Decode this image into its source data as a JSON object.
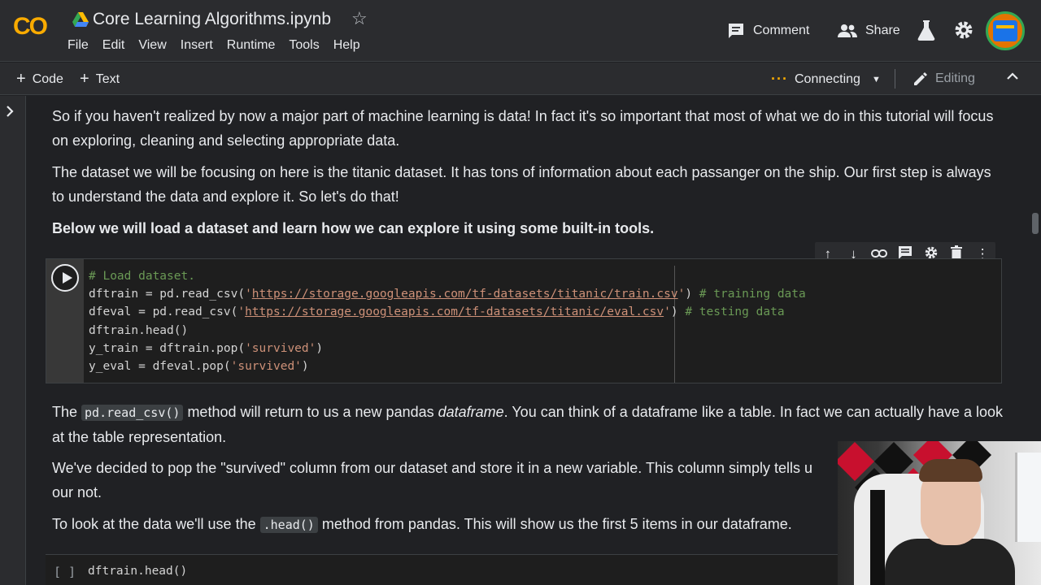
{
  "header": {
    "logo": "CO",
    "title": "Core Learning Algorithms.ipynb",
    "menu": [
      "File",
      "Edit",
      "View",
      "Insert",
      "Runtime",
      "Tools",
      "Help"
    ],
    "comment_label": "Comment",
    "share_label": "Share"
  },
  "toolbar": {
    "add_code": "Code",
    "add_text": "Text",
    "status": "Connecting",
    "mode": "Editing"
  },
  "cells": {
    "para1": "So if you haven't realized by now a major part of machine learning is data! In fact it's so important that most of what we do in this tutorial will focus on exploring, cleaning and selecting appropriate data.",
    "para2": "The dataset we will be focusing on here is the titanic dataset. It has tons of information about each passanger on the ship. Our first step is always to understand the data and explore it. So let's do that!",
    "para3": "Below we will load a dataset and learn how we can explore it using some built-in tools.",
    "code": {
      "l1": "# Load dataset.",
      "l2_a": "dftrain = pd.read_csv(",
      "l2_url": "https://storage.googleapis.com/tf-datasets/titanic/train.csv",
      "l2_b": ") ",
      "l2_c": "# training data",
      "l3_a": "dfeval = pd.read_csv(",
      "l3_url": "https://storage.googleapis.com/tf-datasets/titanic/eval.csv",
      "l3_b": ") ",
      "l3_c": "# testing data",
      "l4": "dftrain.head()",
      "l5_a": "y_train = dftrain.pop(",
      "l5_s": "'survived'",
      "l5_b": ")",
      "l6_a": "y_eval = dfeval.pop(",
      "l6_s": "'survived'",
      "l6_b": ")"
    },
    "para4_a": "The ",
    "para4_code": "pd.read_csv()",
    "para4_b": " method will return to us a new pandas ",
    "para4_i": "dataframe",
    "para4_c": ". You can think of a dataframe like a table. In fact we can actually have a look at the table representation.",
    "para5": "We've decided to pop the \"survived\" column from our dataset and store it in a new variable. This column simply tells u",
    "para5_2": "our not.",
    "para6_a": "To look at the data we'll use the ",
    "para6_code": ".head()",
    "para6_b": " method from pandas. This will show us the first 5 items in our dataframe.",
    "code2_bracket": "[ ]",
    "code2": "dftrain.head()"
  }
}
